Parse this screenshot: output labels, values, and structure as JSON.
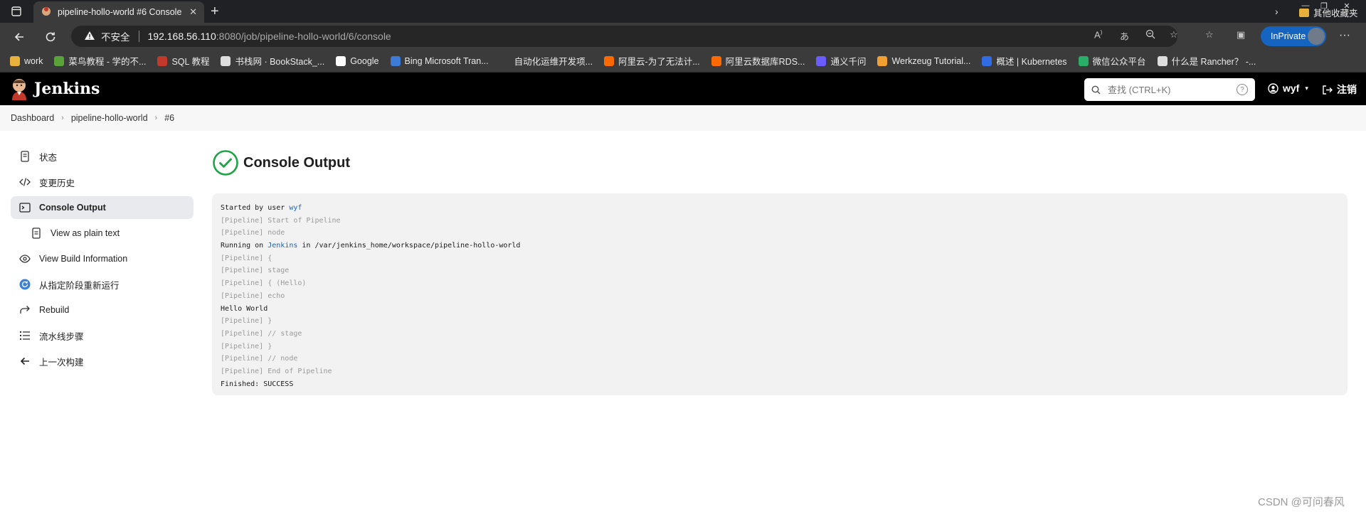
{
  "browser": {
    "tab_title": "pipeline-hollo-world #6 Console",
    "insecure_label": "不安全",
    "url_host": "192.168.56.110",
    "url_path": ":8080/job/pipeline-hollo-world/6/console",
    "inprivate_label": "InPrivate",
    "bookmarks": [
      {
        "label": "work",
        "color": "#e8b13b"
      },
      {
        "label": "菜鸟教程 - 学的不...",
        "color": "#5aa33b"
      },
      {
        "label": "SQL 教程",
        "color": "#c0392b"
      },
      {
        "label": "书栈网 · BookStack_...",
        "color": "#dddddd"
      },
      {
        "label": "Google",
        "color": "#ffffff"
      },
      {
        "label": "Bing Microsoft Tran...",
        "color": "#3d7bd9"
      },
      {
        "label": "自动化运维开发项...",
        "color": "#3b3b3b"
      },
      {
        "label": "阿里云-为了无法计...",
        "color": "#ff6a00"
      },
      {
        "label": "阿里云数据库RDS...",
        "color": "#ff6a00"
      },
      {
        "label": "通义千问",
        "color": "#6b5cff"
      },
      {
        "label": "Werkzeug Tutorial...",
        "color": "#f0a030"
      },
      {
        "label": "概述 | Kubernetes",
        "color": "#326ce5"
      },
      {
        "label": "微信公众平台",
        "color": "#2aae67"
      },
      {
        "label": "什么是 Rancher？ -...",
        "color": "#dddddd"
      }
    ],
    "other_bookmarks": "其他收藏夹"
  },
  "jenkins": {
    "brand": "Jenkins",
    "search_placeholder": "查找 (CTRL+K)",
    "user": "wyf",
    "logout": "注销"
  },
  "breadcrumb": [
    "Dashboard",
    "pipeline-hollo-world",
    "#6"
  ],
  "sidebar": {
    "items": [
      {
        "label": "状态",
        "icon": "document-icon"
      },
      {
        "label": "变更历史",
        "icon": "code-icon"
      },
      {
        "label": "Console Output",
        "icon": "terminal-icon"
      },
      {
        "label": "View as plain text",
        "icon": "document-icon"
      },
      {
        "label": "View Build Information",
        "icon": "eye-icon"
      },
      {
        "label": "从指定阶段重新运行",
        "icon": "refresh-icon"
      },
      {
        "label": "Rebuild",
        "icon": "redo-icon"
      },
      {
        "label": "流水线步骤",
        "icon": "list-icon"
      },
      {
        "label": "上一次构建",
        "icon": "arrow-left-icon"
      }
    ]
  },
  "main": {
    "title": "Console Output",
    "console": {
      "started_prefix": "Started by user ",
      "started_user": "wyf",
      "running_prefix": "Running on ",
      "running_node": "Jenkins",
      "running_suffix": " in /var/jenkins_home/workspace/pipeline-hollo-world",
      "lines": [
        "[Pipeline] Start of Pipeline",
        "[Pipeline] node",
        "[Pipeline] {",
        "[Pipeline] stage",
        "[Pipeline] { (Hello)",
        "[Pipeline] echo",
        "Hello World",
        "[Pipeline] }",
        "[Pipeline] // stage",
        "[Pipeline] }",
        "[Pipeline] // node",
        "[Pipeline] End of Pipeline",
        "Finished: SUCCESS"
      ]
    }
  },
  "watermark": "CSDN @可问春风",
  "colors": {
    "success": "#1ea446",
    "link": "#1565c0",
    "header_bg": "#000000",
    "inprivate": "#1565c0"
  }
}
